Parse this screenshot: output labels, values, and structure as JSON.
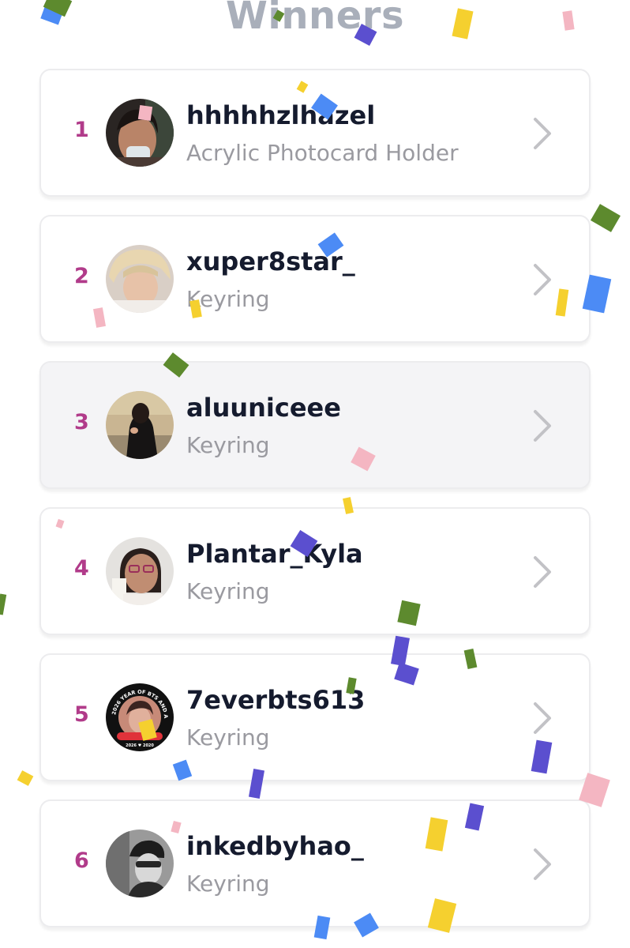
{
  "page": {
    "title": "Winners"
  },
  "colors": {
    "title": "#a9afba",
    "rank": "#b13b8a",
    "username": "#151b2e",
    "prize": "#9a9aa0",
    "card_border": "#ececee",
    "card_highlight": "#f4f4f6",
    "chevron": "#c2c2c6",
    "confetti": [
      "#4c8bf5",
      "#f5d02f",
      "#5b4fcf",
      "#5d8a2e",
      "#f4b6c2"
    ]
  },
  "winners": [
    {
      "rank": "1",
      "username": "hhhhhzlhazel",
      "prize": "Acrylic Photocard Holder",
      "avatar": "avatar-photo-icon"
    },
    {
      "rank": "2",
      "username": "xuper8star_",
      "prize": "Keyring",
      "avatar": "avatar-photo-icon"
    },
    {
      "rank": "3",
      "username": "aluuniceee",
      "prize": "Keyring",
      "avatar": "avatar-photo-icon",
      "highlighted": true
    },
    {
      "rank": "4",
      "username": "Plantar_Kyla",
      "prize": "Keyring",
      "avatar": "avatar-photo-icon"
    },
    {
      "rank": "5",
      "username": "7everbts613",
      "prize": "Keyring",
      "avatar": "avatar-badge-icon",
      "avatar_text": [
        "2026 YEAR OF BTS AND ARMY",
        "2026 ♥ 2020"
      ]
    },
    {
      "rank": "6",
      "username": "inkedbyhao_",
      "prize": "Keyring",
      "avatar": "avatar-photo-icon"
    }
  ]
}
